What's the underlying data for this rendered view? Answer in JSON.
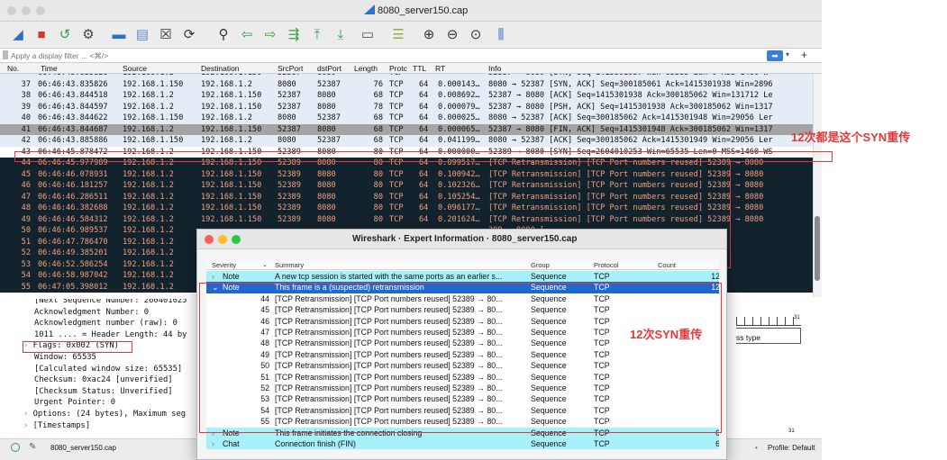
{
  "window": {
    "title": "8080_server150.cap"
  },
  "toolbar": {
    "icons": [
      "shark-fin-start-icon",
      "stop-icon",
      "restart-icon",
      "options-gear-icon",
      "open-folder-icon",
      "save-file-icon",
      "close-file-icon",
      "reload-icon",
      "search-icon",
      "go-back-icon",
      "go-forward-icon",
      "go-to-packet-icon",
      "go-first-icon",
      "go-last-icon",
      "autoscroll-icon",
      "colorize-icon",
      "zoom-in-icon",
      "zoom-out-icon",
      "zoom-normal-icon",
      "resize-columns-icon"
    ]
  },
  "filter": {
    "placeholder": "Apply a display filter ... <⌘/>"
  },
  "columns": {
    "no": "No.",
    "time": "Time",
    "source": "Source",
    "destination": "Destination",
    "srcport": "SrcPort",
    "dstport": "dstPort",
    "length": "Length",
    "protocol": "Protc",
    "ttl": "TTL",
    "rt": "RT",
    "info": "Info"
  },
  "packets": [
    {
      "no": "",
      "time": "06:46:43.835826",
      "src": "192.168.1.2",
      "dst": "192.168.1.150",
      "sp": "52387",
      "dp": "8080",
      "len": "",
      "proto": "TCP",
      "ttl": "",
      "rt": "",
      "info": "52387 → 8080 [SYN] Seq=1415301937 Win=65535 Len=0 MSS=1460 W",
      "style": "partial"
    },
    {
      "no": "37",
      "time": "06:46:43.835826",
      "src": "192.168.1.150",
      "dst": "192.168.1.2",
      "sp": "8080",
      "dp": "52387",
      "len": "76",
      "proto": "TCP",
      "ttl": "64",
      "rt": "0.000143…",
      "info": "8080 → 52387 [SYN, ACK] Seq=300185061 Ack=1415301938 Win=2896",
      "style": "white"
    },
    {
      "no": "38",
      "time": "06:46:43.844518",
      "src": "192.168.1.2",
      "dst": "192.168.1.150",
      "sp": "52387",
      "dp": "8080",
      "len": "68",
      "proto": "TCP",
      "ttl": "64",
      "rt": "0.008692…",
      "info": "52387 → 8080 [ACK] Seq=1415301938 Ack=300185062 Win=131712 Le",
      "style": "white"
    },
    {
      "no": "39",
      "time": "06:46:43.844597",
      "src": "192.168.1.2",
      "dst": "192.168.1.150",
      "sp": "52387",
      "dp": "8080",
      "len": "78",
      "proto": "TCP",
      "ttl": "64",
      "rt": "0.000079…",
      "info": "52387 → 8080 [PSH, ACK] Seq=1415301938 Ack=300185062 Win=1317",
      "style": "white"
    },
    {
      "no": "40",
      "time": "06:46:43.844622",
      "src": "192.168.1.150",
      "dst": "192.168.1.2",
      "sp": "8080",
      "dp": "52387",
      "len": "68",
      "proto": "TCP",
      "ttl": "64",
      "rt": "0.000025…",
      "info": "8080 → 52387 [ACK] Seq=300185062 Ack=1415301948 Win=29056 Ler",
      "style": "white"
    },
    {
      "no": "41",
      "time": "06:46:43.844687",
      "src": "192.168.1.2",
      "dst": "192.168.1.150",
      "sp": "52387",
      "dp": "8080",
      "len": "68",
      "proto": "TCP",
      "ttl": "64",
      "rt": "0.000065…",
      "info": "52387 → 8080 [FIN, ACK] Seq=1415301948 Ack=300185062 Win=1317",
      "style": "gray"
    },
    {
      "no": "42",
      "time": "06:46:43.885886",
      "src": "192.168.1.150",
      "dst": "192.168.1.2",
      "sp": "8080",
      "dp": "52387",
      "len": "68",
      "proto": "TCP",
      "ttl": "64",
      "rt": "0.041199…",
      "info": "8080 → 52387 [ACK] Seq=300185062 Ack=1415301949 Win=29056 Ler",
      "style": "white"
    },
    {
      "no": "43",
      "time": "06:46:45.878472",
      "src": "192.168.1.2",
      "dst": "192.168.1.150",
      "sp": "52389",
      "dp": "8080",
      "len": "80",
      "proto": "TCP",
      "ttl": "64",
      "rt": "0.000000…",
      "info": "52389 → 8080 [SYN] Seq=2604010253 Win=65535 Len=0 MSS=1460 WS",
      "style": "sel"
    },
    {
      "no": "44",
      "time": "06:46:45.977989",
      "src": "192.168.1.2",
      "dst": "192.168.1.150",
      "sp": "52389",
      "dp": "8080",
      "len": "80",
      "proto": "TCP",
      "ttl": "64",
      "rt": "0.099517…",
      "info": "[TCP Retransmission] [TCP Port numbers reused] 52389 → 8080",
      "style": "dark"
    },
    {
      "no": "45",
      "time": "06:46:46.078931",
      "src": "192.168.1.2",
      "dst": "192.168.1.150",
      "sp": "52389",
      "dp": "8080",
      "len": "80",
      "proto": "TCP",
      "ttl": "64",
      "rt": "0.100942…",
      "info": "[TCP Retransmission] [TCP Port numbers reused] 52389 → 8080",
      "style": "dark"
    },
    {
      "no": "46",
      "time": "06:46:46.181257",
      "src": "192.168.1.2",
      "dst": "192.168.1.150",
      "sp": "52389",
      "dp": "8080",
      "len": "80",
      "proto": "TCP",
      "ttl": "64",
      "rt": "0.102326…",
      "info": "[TCP Retransmission] [TCP Port numbers reused] 52389 → 8080",
      "style": "dark"
    },
    {
      "no": "47",
      "time": "06:46:46.286511",
      "src": "192.168.1.2",
      "dst": "192.168.1.150",
      "sp": "52389",
      "dp": "8080",
      "len": "80",
      "proto": "TCP",
      "ttl": "64",
      "rt": "0.105254…",
      "info": "[TCP Retransmission] [TCP Port numbers reused] 52389 → 8080",
      "style": "dark"
    },
    {
      "no": "48",
      "time": "06:46:46.382688",
      "src": "192.168.1.2",
      "dst": "192.168.1.150",
      "sp": "52389",
      "dp": "8080",
      "len": "80",
      "proto": "TCP",
      "ttl": "64",
      "rt": "0.096177…",
      "info": "[TCP Retransmission] [TCP Port numbers reused] 52389 → 8080",
      "style": "dark"
    },
    {
      "no": "49",
      "time": "06:46:46.584312",
      "src": "192.168.1.2",
      "dst": "192.168.1.150",
      "sp": "52389",
      "dp": "8080",
      "len": "80",
      "proto": "TCP",
      "ttl": "64",
      "rt": "0.201624…",
      "info": "[TCP Retransmission] [TCP Port numbers reused] 52389 → 8080",
      "style": "dark"
    },
    {
      "no": "50",
      "time": "06:46:46.989537",
      "src": "192.168.1.2",
      "dst": "",
      "sp": "",
      "dp": "",
      "len": "",
      "proto": "",
      "ttl": "",
      "rt": "",
      "info": "389 → 8080 [",
      "style": "dark"
    },
    {
      "no": "51",
      "time": "06:46:47.786470",
      "src": "192.168.1.2",
      "dst": "",
      "sp": "",
      "dp": "",
      "len": "",
      "proto": "",
      "ttl": "",
      "rt": "",
      "info": "389 → 8080 [",
      "style": "dark"
    },
    {
      "no": "52",
      "time": "06:46:49.385201",
      "src": "192.168.1.2",
      "dst": "",
      "sp": "",
      "dp": "",
      "len": "",
      "proto": "",
      "ttl": "",
      "rt": "",
      "info": "389 → 8080 [",
      "style": "dark"
    },
    {
      "no": "53",
      "time": "06:46:52.586254",
      "src": "192.168.1.2",
      "dst": "",
      "sp": "",
      "dp": "",
      "len": "",
      "proto": "",
      "ttl": "",
      "rt": "",
      "info": "389 → 8080 [",
      "style": "dark"
    },
    {
      "no": "54",
      "time": "06:46:58.987042",
      "src": "192.168.1.2",
      "dst": "",
      "sp": "",
      "dp": "",
      "len": "",
      "proto": "",
      "ttl": "",
      "rt": "",
      "info": "389 → 8080 [",
      "style": "dark"
    },
    {
      "no": "55",
      "time": "06:47:05.398012",
      "src": "192.168.1.2",
      "dst": "",
      "sp": "",
      "dp": "",
      "len": "",
      "proto": "",
      "ttl": "",
      "rt": "",
      "info": "389 → 8080 [SYN] S",
      "style": "dark"
    }
  ],
  "details": [
    {
      "text": "[Next Sequence Number: 260401025"
    },
    {
      "text": "Acknowledgment Number: 0"
    },
    {
      "text": "Acknowledgment number (raw): 0"
    },
    {
      "text": "1011 .... = Header Length: 44 by"
    },
    {
      "text": "Flags: 0x002 (SYN)"
    },
    {
      "text": "Window: 65535"
    },
    {
      "text": "[Calculated window size: 65535]"
    },
    {
      "text": "Checksum: 0xac24 [unverified]"
    },
    {
      "text": "[Checksum Status: Unverified]"
    },
    {
      "text": "Urgent Pointer: 0"
    },
    {
      "text": "Options: (24 bytes), Maximum seg"
    },
    {
      "text": "[Timestamps]"
    }
  ],
  "bytes_pane": {
    "ruler_label": "31",
    "text": "ss type",
    "ruler_label2": "31"
  },
  "status": {
    "file": "8080_server150.cap",
    "profile": "Profile: Default"
  },
  "expert": {
    "title": "Wireshark · Expert Information · 8080_server150.cap",
    "headers": {
      "severity": "Severity",
      "summary": "Summary",
      "group": "Group",
      "protocol": "Protocol",
      "count": "Count"
    },
    "groups": [
      {
        "severity": "Note",
        "summary": "A new tcp session is started with the same ports as an earlier s...",
        "group": "Sequence",
        "protocol": "TCP",
        "count": "12",
        "style": "cyan",
        "arrow": "›"
      },
      {
        "severity": "Note",
        "summary": "This frame is a (suspected) retransmission",
        "group": "Sequence",
        "protocol": "TCP",
        "count": "12",
        "style": "blue",
        "arrow": "⌄"
      }
    ],
    "children": [
      {
        "no": "44",
        "summary": "[TCP Retransmission] [TCP Port numbers reused] 52389 → 80...",
        "group": "Sequence",
        "protocol": "TCP"
      },
      {
        "no": "45",
        "summary": "[TCP Retransmission] [TCP Port numbers reused] 52389 → 80...",
        "group": "Sequence",
        "protocol": "TCP"
      },
      {
        "no": "46",
        "summary": "[TCP Retransmission] [TCP Port numbers reused] 52389 → 80...",
        "group": "Sequence",
        "protocol": "TCP"
      },
      {
        "no": "47",
        "summary": "[TCP Retransmission] [TCP Port numbers reused] 52389 → 80...",
        "group": "Sequence",
        "protocol": "TCP"
      },
      {
        "no": "48",
        "summary": "[TCP Retransmission] [TCP Port numbers reused] 52389 → 80...",
        "group": "Sequence",
        "protocol": "TCP"
      },
      {
        "no": "49",
        "summary": "[TCP Retransmission] [TCP Port numbers reused] 52389 → 80...",
        "group": "Sequence",
        "protocol": "TCP"
      },
      {
        "no": "50",
        "summary": "[TCP Retransmission] [TCP Port numbers reused] 52389 → 80...",
        "group": "Sequence",
        "protocol": "TCP"
      },
      {
        "no": "51",
        "summary": "[TCP Retransmission] [TCP Port numbers reused] 52389 → 80...",
        "group": "Sequence",
        "protocol": "TCP"
      },
      {
        "no": "52",
        "summary": "[TCP Retransmission] [TCP Port numbers reused] 52389 → 80...",
        "group": "Sequence",
        "protocol": "TCP"
      },
      {
        "no": "53",
        "summary": "[TCP Retransmission] [TCP Port numbers reused] 52389 → 80...",
        "group": "Sequence",
        "protocol": "TCP"
      },
      {
        "no": "54",
        "summary": "[TCP Retransmission] [TCP Port numbers reused] 52389 → 80...",
        "group": "Sequence",
        "protocol": "TCP"
      },
      {
        "no": "55",
        "summary": "[TCP Retransmission] [TCP Port numbers reused] 52389 → 80...",
        "group": "Sequence",
        "protocol": "TCP"
      }
    ],
    "tail": [
      {
        "severity": "Note",
        "summary": "This frame initiates the connection closing",
        "group": "Sequence",
        "protocol": "TCP",
        "count": "6",
        "arrow": "›"
      },
      {
        "severity": "Chat",
        "summary": "Connection finish (FIN)",
        "group": "Sequence",
        "protocol": "TCP",
        "count": "6",
        "arrow": "›"
      }
    ]
  },
  "annotations": {
    "note_right": "12次都是这个SYN重传",
    "note_dialog": "12次SYN重传",
    "color": "#e23a3a"
  }
}
